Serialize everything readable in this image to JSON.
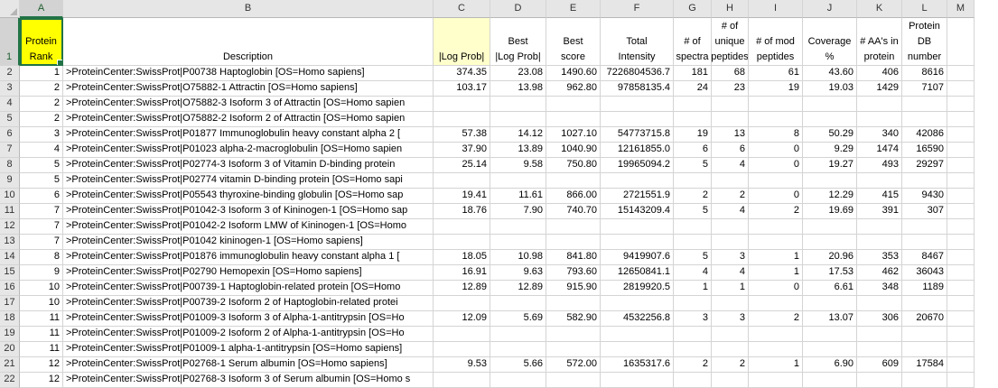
{
  "columns": [
    "A",
    "B",
    "C",
    "D",
    "E",
    "F",
    "G",
    "H",
    "I",
    "J",
    "K",
    "L",
    "M"
  ],
  "selected_column": "A",
  "selected_row": "1",
  "header_row": {
    "row_number": "1",
    "cells": [
      [
        "Protein",
        "Rank"
      ],
      [
        "Description"
      ],
      [
        "|Log Prob|"
      ],
      [
        "Best",
        "|Log Prob|"
      ],
      [
        "Best",
        "score"
      ],
      [
        "Total",
        "Intensity"
      ],
      [
        "# of",
        "spectra"
      ],
      [
        "# of",
        "unique",
        "peptides"
      ],
      [
        "# of mod",
        "peptides"
      ],
      [
        "Coverage",
        "%"
      ],
      [
        "# AA's in",
        "protein"
      ],
      [
        "Protein",
        "DB",
        "number"
      ],
      []
    ]
  },
  "rows": [
    {
      "n": "2",
      "rank": "1",
      "desc": ">ProteinCenter:SwissProt|P00738 Haptoglobin [OS=Homo sapiens]",
      "c": "374.35",
      "d": "23.08",
      "e": "1490.60",
      "f": "7226804536.7",
      "g": "181",
      "h": "68",
      "i": "61",
      "j": "43.60",
      "k": "406",
      "l": "8616"
    },
    {
      "n": "3",
      "rank": "2",
      "desc": ">ProteinCenter:SwissProt|O75882-1 Attractin [OS=Homo sapiens]",
      "c": "103.17",
      "d": "13.98",
      "e": "962.80",
      "f": "97858135.4",
      "g": "24",
      "h": "23",
      "i": "19",
      "j": "19.03",
      "k": "1429",
      "l": "7107"
    },
    {
      "n": "4",
      "rank": "2",
      "desc": ">ProteinCenter:SwissProt|O75882-3 Isoform 3 of Attractin [OS=Homo sapien",
      "c": "",
      "d": "",
      "e": "",
      "f": "",
      "g": "",
      "h": "",
      "i": "",
      "j": "",
      "k": "",
      "l": ""
    },
    {
      "n": "5",
      "rank": "2",
      "desc": ">ProteinCenter:SwissProt|O75882-2 Isoform 2 of Attractin [OS=Homo sapien",
      "c": "",
      "d": "",
      "e": "",
      "f": "",
      "g": "",
      "h": "",
      "i": "",
      "j": "",
      "k": "",
      "l": ""
    },
    {
      "n": "6",
      "rank": "3",
      "desc": ">ProteinCenter:SwissProt|P01877 Immunoglobulin heavy constant alpha 2 [",
      "c": "57.38",
      "d": "14.12",
      "e": "1027.10",
      "f": "54773715.8",
      "g": "19",
      "h": "13",
      "i": "8",
      "j": "50.29",
      "k": "340",
      "l": "42086"
    },
    {
      "n": "7",
      "rank": "4",
      "desc": ">ProteinCenter:SwissProt|P01023 alpha-2-macroglobulin [OS=Homo sapien",
      "c": "37.90",
      "d": "13.89",
      "e": "1040.90",
      "f": "12161855.0",
      "g": "6",
      "h": "6",
      "i": "0",
      "j": "9.29",
      "k": "1474",
      "l": "16590"
    },
    {
      "n": "8",
      "rank": "5",
      "desc": ">ProteinCenter:SwissProt|P02774-3 Isoform 3 of Vitamin D-binding protein",
      "c": "25.14",
      "d": "9.58",
      "e": "750.80",
      "f": "19965094.2",
      "g": "5",
      "h": "4",
      "i": "0",
      "j": "19.27",
      "k": "493",
      "l": "29297"
    },
    {
      "n": "9",
      "rank": "5",
      "desc": ">ProteinCenter:SwissProt|P02774 vitamin D-binding protein [OS=Homo sapi",
      "c": "",
      "d": "",
      "e": "",
      "f": "",
      "g": "",
      "h": "",
      "i": "",
      "j": "",
      "k": "",
      "l": ""
    },
    {
      "n": "10",
      "rank": "6",
      "desc": ">ProteinCenter:SwissProt|P05543 thyroxine-binding globulin [OS=Homo sap",
      "c": "19.41",
      "d": "11.61",
      "e": "866.00",
      "f": "2721551.9",
      "g": "2",
      "h": "2",
      "i": "0",
      "j": "12.29",
      "k": "415",
      "l": "9430"
    },
    {
      "n": "11",
      "rank": "7",
      "desc": ">ProteinCenter:SwissProt|P01042-3 Isoform 3 of Kininogen-1 [OS=Homo sap",
      "c": "18.76",
      "d": "7.90",
      "e": "740.70",
      "f": "15143209.4",
      "g": "5",
      "h": "4",
      "i": "2",
      "j": "19.69",
      "k": "391",
      "l": "307"
    },
    {
      "n": "12",
      "rank": "7",
      "desc": ">ProteinCenter:SwissProt|P01042-2 Isoform LMW of Kininogen-1 [OS=Homo",
      "c": "",
      "d": "",
      "e": "",
      "f": "",
      "g": "",
      "h": "",
      "i": "",
      "j": "",
      "k": "",
      "l": ""
    },
    {
      "n": "13",
      "rank": "7",
      "desc": ">ProteinCenter:SwissProt|P01042 kininogen-1 [OS=Homo sapiens]",
      "c": "",
      "d": "",
      "e": "",
      "f": "",
      "g": "",
      "h": "",
      "i": "",
      "j": "",
      "k": "",
      "l": ""
    },
    {
      "n": "14",
      "rank": "8",
      "desc": ">ProteinCenter:SwissProt|P01876 immunoglobulin heavy constant alpha 1 [",
      "c": "18.05",
      "d": "10.98",
      "e": "841.80",
      "f": "9419907.6",
      "g": "5",
      "h": "3",
      "i": "1",
      "j": "20.96",
      "k": "353",
      "l": "8467"
    },
    {
      "n": "15",
      "rank": "9",
      "desc": ">ProteinCenter:SwissProt|P02790 Hemopexin [OS=Homo sapiens]",
      "c": "16.91",
      "d": "9.63",
      "e": "793.60",
      "f": "12650841.1",
      "g": "4",
      "h": "4",
      "i": "1",
      "j": "17.53",
      "k": "462",
      "l": "36043"
    },
    {
      "n": "16",
      "rank": "10",
      "desc": ">ProteinCenter:SwissProt|P00739-1 Haptoglobin-related protein [OS=Homo",
      "c": "12.89",
      "d": "12.89",
      "e": "915.90",
      "f": "2819920.5",
      "g": "1",
      "h": "1",
      "i": "0",
      "j": "6.61",
      "k": "348",
      "l": "1189"
    },
    {
      "n": "17",
      "rank": "10",
      "desc": ">ProteinCenter:SwissProt|P00739-2 Isoform 2 of Haptoglobin-related protei",
      "c": "",
      "d": "",
      "e": "",
      "f": "",
      "g": "",
      "h": "",
      "i": "",
      "j": "",
      "k": "",
      "l": ""
    },
    {
      "n": "18",
      "rank": "11",
      "desc": ">ProteinCenter:SwissProt|P01009-3 Isoform 3 of Alpha-1-antitrypsin [OS=Ho",
      "c": "12.09",
      "d": "5.69",
      "e": "582.90",
      "f": "4532256.8",
      "g": "3",
      "h": "3",
      "i": "2",
      "j": "13.07",
      "k": "306",
      "l": "20670"
    },
    {
      "n": "19",
      "rank": "11",
      "desc": ">ProteinCenter:SwissProt|P01009-2 Isoform 2 of Alpha-1-antitrypsin [OS=Ho",
      "c": "",
      "d": "",
      "e": "",
      "f": "",
      "g": "",
      "h": "",
      "i": "",
      "j": "",
      "k": "",
      "l": ""
    },
    {
      "n": "20",
      "rank": "11",
      "desc": ">ProteinCenter:SwissProt|P01009-1 alpha-1-antitrypsin [OS=Homo sapiens]",
      "c": "",
      "d": "",
      "e": "",
      "f": "",
      "g": "",
      "h": "",
      "i": "",
      "j": "",
      "k": "",
      "l": ""
    },
    {
      "n": "21",
      "rank": "12",
      "desc": ">ProteinCenter:SwissProt|P02768-1 Serum albumin [OS=Homo sapiens]",
      "c": "9.53",
      "d": "5.66",
      "e": "572.00",
      "f": "1635317.6",
      "g": "2",
      "h": "2",
      "i": "1",
      "j": "6.90",
      "k": "609",
      "l": "17584"
    },
    {
      "n": "22",
      "rank": "12",
      "desc": ">ProteinCenter:SwissProt|P02768-3 Isoform 3 of Serum albumin [OS=Homo s",
      "c": "",
      "d": "",
      "e": "",
      "f": "",
      "g": "",
      "h": "",
      "i": "",
      "j": "",
      "k": "",
      "l": ""
    }
  ],
  "colors": {
    "header_fill_A": "#ffff00",
    "header_fill_C": "#ffffcc",
    "selection_green": "#217346"
  }
}
